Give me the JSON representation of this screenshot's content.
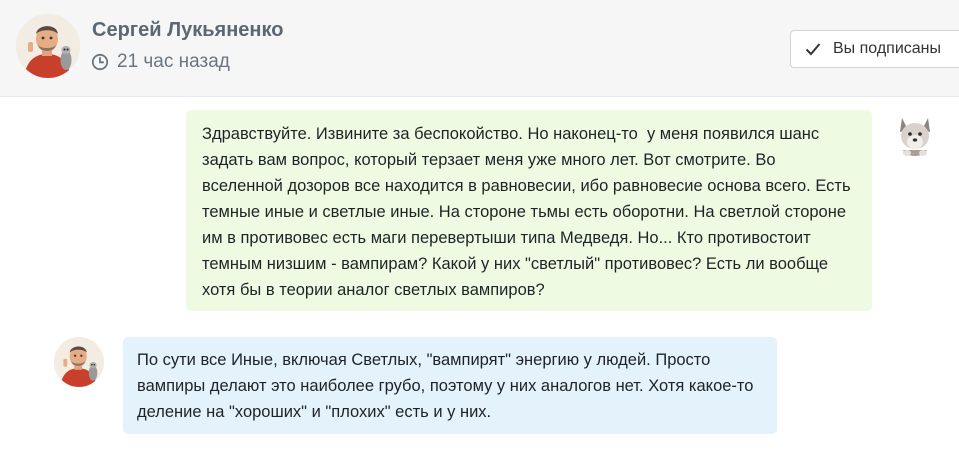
{
  "header": {
    "author_name": "Сергей Лукьяненко",
    "time_ago": "21 час назад",
    "clock_icon": "clock-icon",
    "subscribe_button": {
      "label": "Вы подписаны",
      "icon": "check-icon"
    }
  },
  "messages": [
    {
      "role": "question",
      "avatar": "wolf-avatar",
      "text": "Здравствуйте. Извините за беспокойство. Но наконец-то  у меня появился шанс задать вам вопрос, который терзает меня уже много лет. Вот смотрите. Во вселенной дозоров все находится в равновесии, ибо равновесие основа всего. Есть темные иные и светлые иные. На стороне тьмы есть оборотни. На светлой стороне им в противовес есть маги перевертыши типа Медведя. Но... Кто противостоит темным низшим - вампирам? Какой у них \"светлый\" противовес? Есть ли вообще хотя бы в теории аналог светлых вампиров?",
      "bubble_color": "#eefbe2"
    },
    {
      "role": "answer",
      "avatar": "author-avatar",
      "text": "По сути все Иные, включая Светлых, \"вампирят\" энергию у людей. Просто вампиры делают это наиболее грубо, поэтому у них аналогов нет. Хотя какое-то деление на \"хороших\" и \"плохих\" есть и у них.",
      "bubble_color": "#e3f2fb"
    }
  ],
  "colors": {
    "header_bg": "#f6f6f7",
    "author_name": "#5c6773",
    "question_bubble": "#eefbe2",
    "answer_bubble": "#e3f2fb"
  }
}
